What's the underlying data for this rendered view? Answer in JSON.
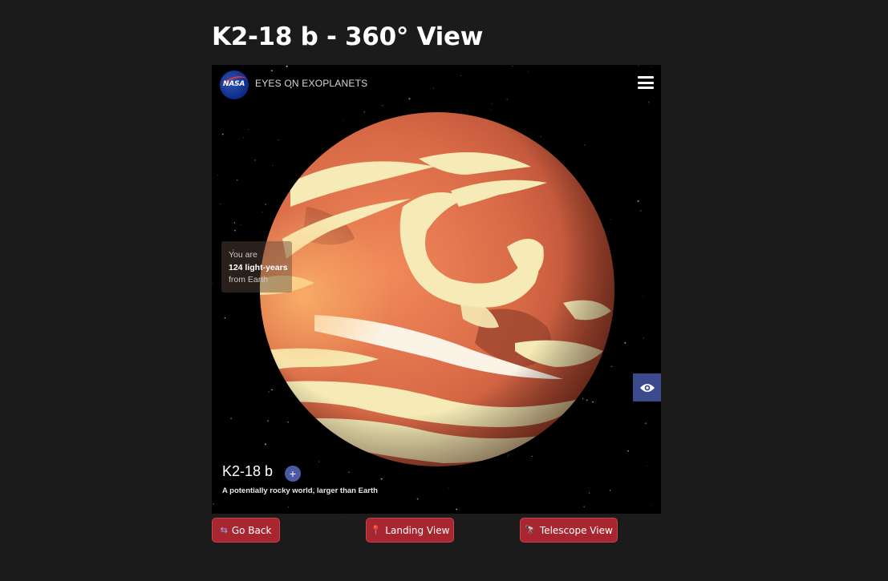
{
  "page": {
    "title": "K2-18 b - 360° View"
  },
  "viewer": {
    "brand": "EYES ON EXOPLANETS",
    "logo_text": "NASA",
    "distance": {
      "line1": "You are",
      "line2": "124 light-years",
      "line3": "from Earth"
    },
    "planet_name": "K2-18 b",
    "plus_label": "+",
    "tagline": "A potentially rocky world, larger than Earth",
    "icons": {
      "menu": "hamburger-menu-icon",
      "eye": "eye-icon"
    }
  },
  "buttons": {
    "go_back": {
      "icon": "⇆",
      "label": "Go Back"
    },
    "landing": {
      "icon": "📍",
      "label": "Landing View"
    },
    "telescope": {
      "icon": "🔭",
      "label": "Telescope View"
    }
  },
  "colors": {
    "background": "#1b1b1b",
    "button": "#a8262f",
    "eye_button": "#3b4a8c",
    "planet_base": "#d9704e",
    "cloud": "#f4e9b3"
  }
}
